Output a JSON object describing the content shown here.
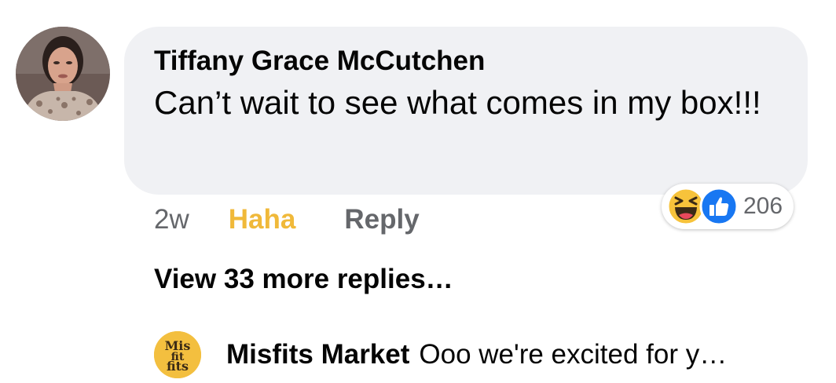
{
  "comment": {
    "author": "Tiffany Grace McCutchen",
    "text": "Can’t wait to see what comes in my box!!!",
    "time": "2w",
    "reaction_label": "Haha",
    "reply_label": "Reply",
    "reaction_count": "206",
    "reaction_icons": [
      "haha-emoji-icon",
      "like-thumb-icon"
    ]
  },
  "view_more": "View 33 more replies…",
  "reply": {
    "author": "Misfits Market",
    "preview": "Ooo we're excited for y…",
    "avatar_logo": "Mis fit fits"
  },
  "colors": {
    "bubble": "#f0f1f4",
    "haha_active": "#f0b93a",
    "secondary_text": "#65676b",
    "like_blue": "#1877f2",
    "misfits_yellow": "#f3bf3f"
  }
}
